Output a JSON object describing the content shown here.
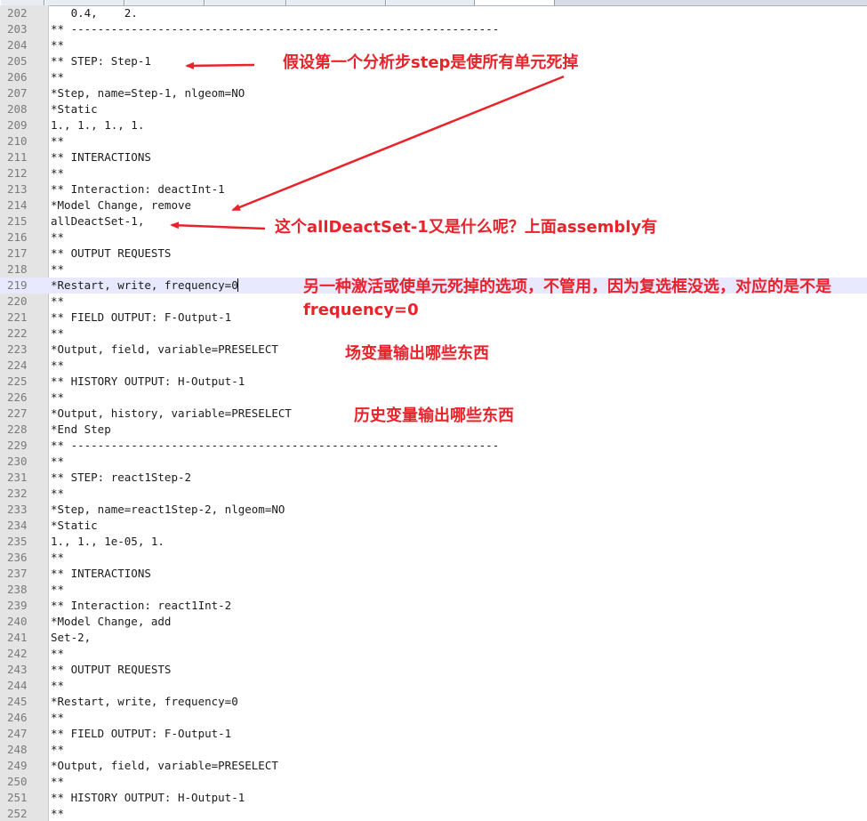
{
  "colors": {
    "annotation": "#e8232b",
    "current_line": "#e8e8ff",
    "gutter": "#e4e4e4"
  },
  "lines": [
    {
      "num": "202",
      "text": "   0.4,    2."
    },
    {
      "num": "203",
      "text": "** ----------------------------------------------------------------"
    },
    {
      "num": "204",
      "text": "**"
    },
    {
      "num": "205",
      "text": "** STEP: Step-1"
    },
    {
      "num": "206",
      "text": "**"
    },
    {
      "num": "207",
      "text": "*Step, name=Step-1, nlgeom=NO"
    },
    {
      "num": "208",
      "text": "*Static"
    },
    {
      "num": "209",
      "text": "1., 1., 1., 1."
    },
    {
      "num": "210",
      "text": "**"
    },
    {
      "num": "211",
      "text": "** INTERACTIONS"
    },
    {
      "num": "212",
      "text": "**"
    },
    {
      "num": "213",
      "text": "** Interaction: deactInt-1"
    },
    {
      "num": "214",
      "text": "*Model Change, remove"
    },
    {
      "num": "215",
      "text": "allDeactSet-1,"
    },
    {
      "num": "216",
      "text": "**"
    },
    {
      "num": "217",
      "text": "** OUTPUT REQUESTS"
    },
    {
      "num": "218",
      "text": "**"
    },
    {
      "num": "219",
      "text": "*Restart, write, frequency=0"
    },
    {
      "num": "220",
      "text": "**"
    },
    {
      "num": "221",
      "text": "** FIELD OUTPUT: F-Output-1"
    },
    {
      "num": "222",
      "text": "**"
    },
    {
      "num": "223",
      "text": "*Output, field, variable=PRESELECT"
    },
    {
      "num": "224",
      "text": "**"
    },
    {
      "num": "225",
      "text": "** HISTORY OUTPUT: H-Output-1"
    },
    {
      "num": "226",
      "text": "**"
    },
    {
      "num": "227",
      "text": "*Output, history, variable=PRESELECT"
    },
    {
      "num": "228",
      "text": "*End Step"
    },
    {
      "num": "229",
      "text": "** ----------------------------------------------------------------"
    },
    {
      "num": "230",
      "text": "**"
    },
    {
      "num": "231",
      "text": "** STEP: react1Step-2"
    },
    {
      "num": "232",
      "text": "**"
    },
    {
      "num": "233",
      "text": "*Step, name=react1Step-2, nlgeom=NO"
    },
    {
      "num": "234",
      "text": "*Static"
    },
    {
      "num": "235",
      "text": "1., 1., 1e-05, 1."
    },
    {
      "num": "236",
      "text": "**"
    },
    {
      "num": "237",
      "text": "** INTERACTIONS"
    },
    {
      "num": "238",
      "text": "**"
    },
    {
      "num": "239",
      "text": "** Interaction: react1Int-2"
    },
    {
      "num": "240",
      "text": "*Model Change, add"
    },
    {
      "num": "241",
      "text": "Set-2,"
    },
    {
      "num": "242",
      "text": "**"
    },
    {
      "num": "243",
      "text": "** OUTPUT REQUESTS"
    },
    {
      "num": "244",
      "text": "**"
    },
    {
      "num": "245",
      "text": "*Restart, write, frequency=0"
    },
    {
      "num": "246",
      "text": "**"
    },
    {
      "num": "247",
      "text": "** FIELD OUTPUT: F-Output-1"
    },
    {
      "num": "248",
      "text": "**"
    },
    {
      "num": "249",
      "text": "*Output, field, variable=PRESELECT"
    },
    {
      "num": "250",
      "text": "**"
    },
    {
      "num": "251",
      "text": "** HISTORY OUTPUT: H-Output-1"
    },
    {
      "num": "252",
      "text": "**"
    }
  ],
  "annotations": {
    "step_note": "假设第一个分析步step是使所有单元死掉",
    "set_note": "这个allDeactSet-1又是什么呢？上面assembly有",
    "restart_note": "另一种激活或使单元死掉的选项，不管用，因为复选框没选，对应的是不是frequency=0",
    "field_note": "场变量输出哪些东西",
    "history_note": "历史变量输出哪些东西"
  }
}
